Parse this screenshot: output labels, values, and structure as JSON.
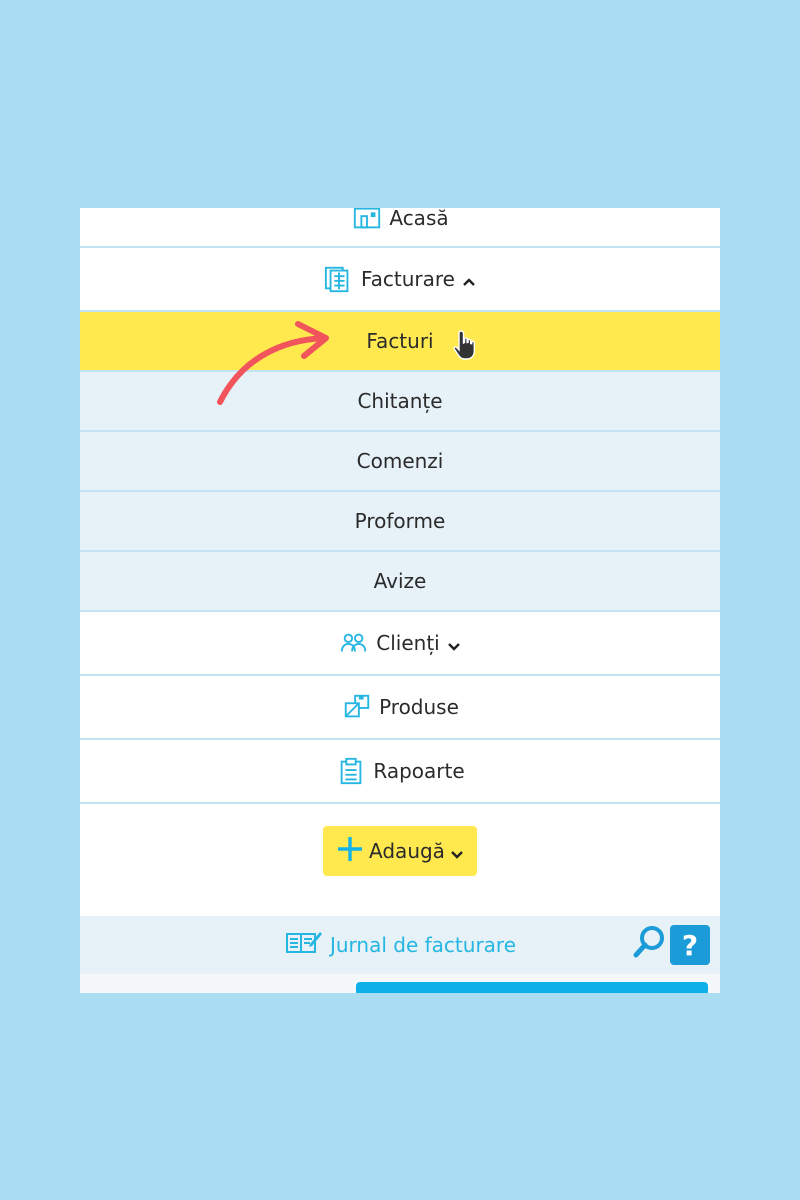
{
  "nav": {
    "home_label": "Acasă",
    "invoicing_label": "Facturare",
    "submenu": [
      "Facturi",
      "Chitanțe",
      "Comenzi",
      "Proforme",
      "Avize"
    ],
    "clients_label": "Clienți",
    "products_label": "Produse",
    "reports_label": "Rapoarte"
  },
  "add_button": {
    "label": "Adaugă"
  },
  "journal": {
    "label": "Jurnal de facturare",
    "help_label": "?"
  },
  "colors": {
    "background": "#aadcf2",
    "highlight": "#ffe94f",
    "accent": "#25b6e2",
    "submenu_bg": "#e6f1f8",
    "annotation_arrow": "#f2545b"
  },
  "icons": {
    "home": "house-icon",
    "invoicing": "invoice-stack-icon",
    "clients": "people-icon",
    "products": "boxes-icon",
    "reports": "clipboard-icon",
    "add": "plus-icon",
    "journal": "book-icon",
    "search": "search-icon",
    "help": "help-icon",
    "cursor": "hand-pointer-icon"
  }
}
